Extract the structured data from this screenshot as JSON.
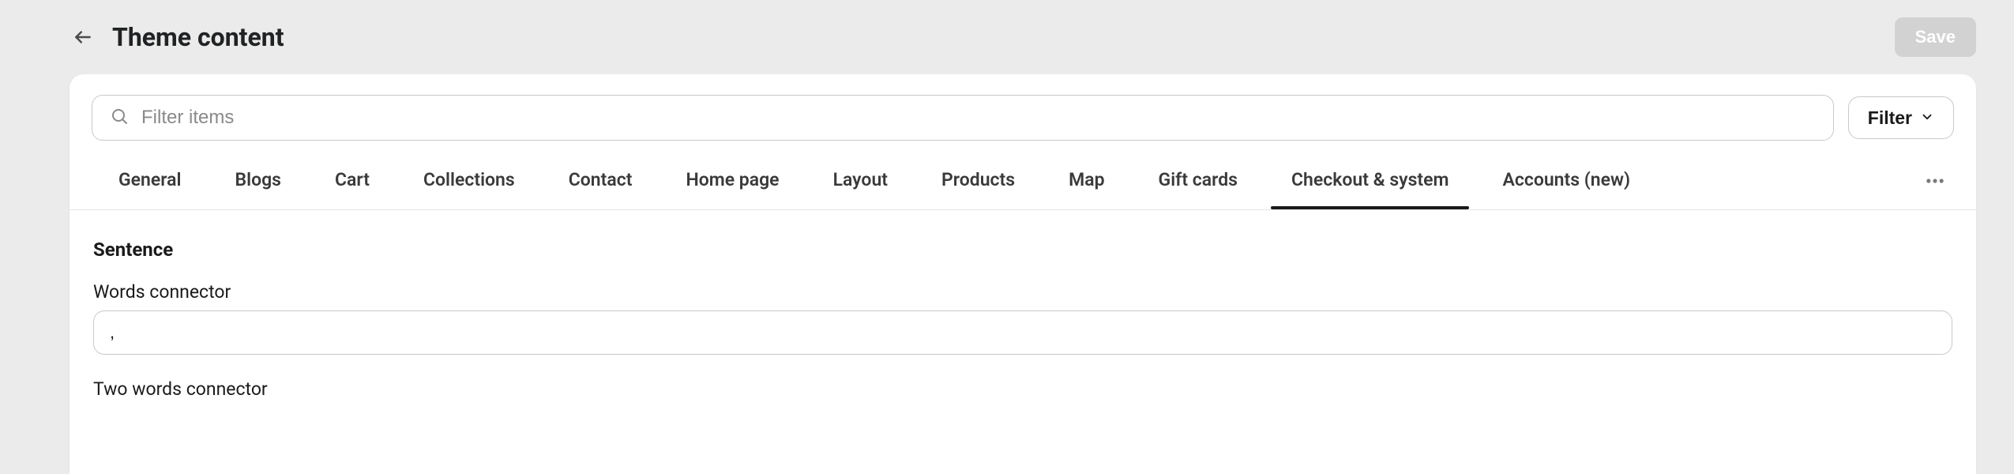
{
  "header": {
    "title": "Theme content",
    "saveLabel": "Save"
  },
  "search": {
    "placeholder": "Filter items"
  },
  "filterButton": {
    "label": "Filter"
  },
  "tabs": [
    {
      "label": "General",
      "active": false
    },
    {
      "label": "Blogs",
      "active": false
    },
    {
      "label": "Cart",
      "active": false
    },
    {
      "label": "Collections",
      "active": false
    },
    {
      "label": "Contact",
      "active": false
    },
    {
      "label": "Home page",
      "active": false
    },
    {
      "label": "Layout",
      "active": false
    },
    {
      "label": "Products",
      "active": false
    },
    {
      "label": "Map",
      "active": false
    },
    {
      "label": "Gift cards",
      "active": false
    },
    {
      "label": "Checkout & system",
      "active": true
    },
    {
      "label": "Accounts (new)",
      "active": false
    }
  ],
  "section": {
    "heading": "Sentence",
    "fields": {
      "wordsConnector": {
        "label": "Words connector",
        "value": ","
      },
      "twoWordsConnector": {
        "label": "Two words connector"
      }
    }
  }
}
